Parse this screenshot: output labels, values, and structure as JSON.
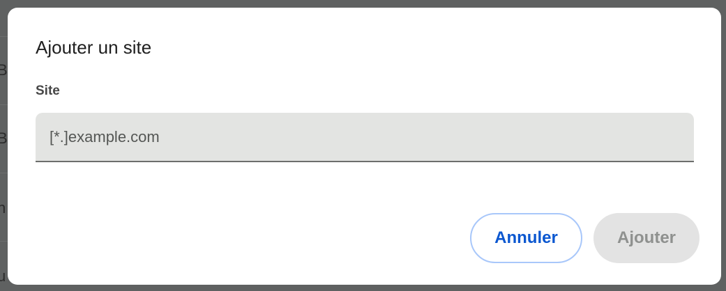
{
  "dialog": {
    "title": "Ajouter un site",
    "field_label": "Site",
    "site_input": {
      "value": "",
      "placeholder": "[*.]example.com"
    },
    "cancel_label": "Annuler",
    "add_label": "Ajouter"
  },
  "background": {
    "row_fragments": [
      "Bl",
      "Bl",
      "n",
      "u"
    ]
  },
  "colors": {
    "accent": "#0b57d0",
    "cancel_border": "#a8c7fa",
    "disabled_button_bg": "#e3e3e3",
    "disabled_button_text": "#8f918f",
    "input_bg": "#e3e4e2",
    "scrim": "#5f6161"
  }
}
